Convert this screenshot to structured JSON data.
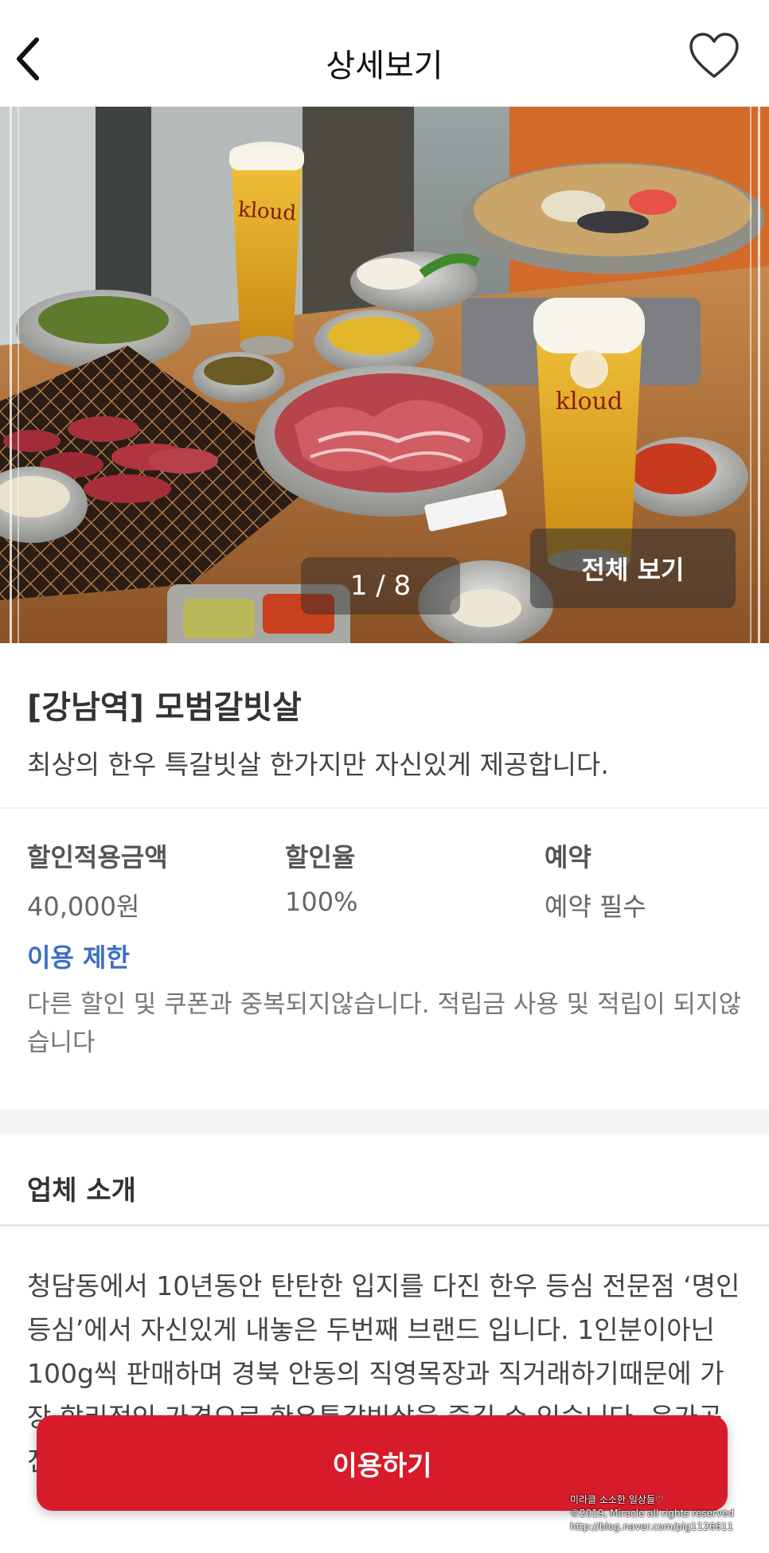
{
  "header": {
    "title": "상세보기",
    "back_icon": "chevron-left-icon",
    "favorite_icon": "heart-outline-icon"
  },
  "gallery": {
    "page_indicator": "1 / 8",
    "view_all_label": "전체 보기",
    "photo_labels": [
      "kloud",
      "kloud"
    ]
  },
  "store": {
    "name": "[강남역] 모범갈빗살",
    "tagline": "최상의 한우 특갈빗살 한가지만 자신있게 제공합니다."
  },
  "details": {
    "discount_amount_label": "할인적용금액",
    "discount_amount_value": "40,000원",
    "discount_rate_label": "할인율",
    "discount_rate_value": "100%",
    "reservation_label": "예약",
    "reservation_value": "예약 필수",
    "restriction_title": "이용 제한",
    "restriction_text": "다른 할인 및 쿠폰과 중복되지않습니다. 적립금 사용 및 적립이 되지않습니다"
  },
  "intro": {
    "title": "업체 소개",
    "text": "청담동에서 10년동안 탄탄한 입지를 다진 한우 등심 전문점 ‘명인등심’에서 자신있게 내놓은 두번째 브랜드 입니다. 1인분이아닌 100g씩 판매하며 경북 안동의 직영목장과 직거래하기때문에 가장 합리적인 가격으로 한우특갈빗살을 즐길 수 있습니다. 육가공 전문가가 매장에서 직접 매일 판매할 양만큼만 한우"
  },
  "cta": {
    "use_label": "이용하기"
  },
  "watermark": {
    "line1": "미라클 소소한 일상들♡",
    "line2": "©2019, Miracle all rights reserved",
    "line3": "http://blog.naver.com/pig1126611"
  },
  "colors": {
    "primary_red": "#d71b2a",
    "link_blue": "#3a6fc4"
  }
}
